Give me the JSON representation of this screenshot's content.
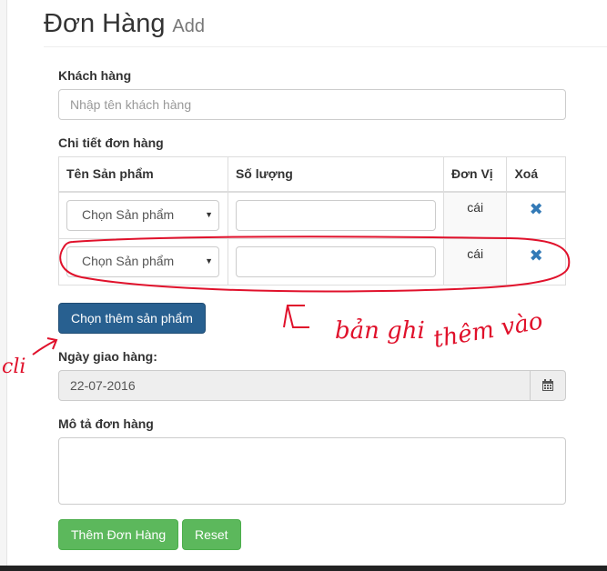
{
  "header": {
    "title": "Đơn Hàng",
    "subtitle": "Add"
  },
  "customer": {
    "label": "Khách hàng",
    "placeholder": "Nhập tên khách hàng",
    "value": ""
  },
  "details": {
    "label": "Chi tiết đơn hàng",
    "columns": [
      "Tên Sản phẩm",
      "Số lượng",
      "Đơn Vị",
      "Xoá"
    ],
    "rows": [
      {
        "product": "Chọn Sản phẩm",
        "quantity": "",
        "unit": "cái",
        "delete_icon": "times-icon"
      },
      {
        "product": "Chọn Sản phẩm",
        "quantity": "",
        "unit": "cái",
        "delete_icon": "times-icon"
      }
    ],
    "add_button": "Chọn thêm sản phẩm"
  },
  "delivery": {
    "label": "Ngày giao hàng:",
    "value": "22-07-2016",
    "icon": "calendar-icon"
  },
  "description": {
    "label": "Mô tả đơn hàng",
    "value": ""
  },
  "actions": {
    "submit": "Thêm Đơn Hàng",
    "reset": "Reset"
  },
  "colors": {
    "primary": "#286090",
    "success": "#5cb85c",
    "link": "#337ab7",
    "annotation": "#e0112b"
  },
  "annotations": [
    "cli",
    "bản ghi",
    "thêm vào"
  ]
}
